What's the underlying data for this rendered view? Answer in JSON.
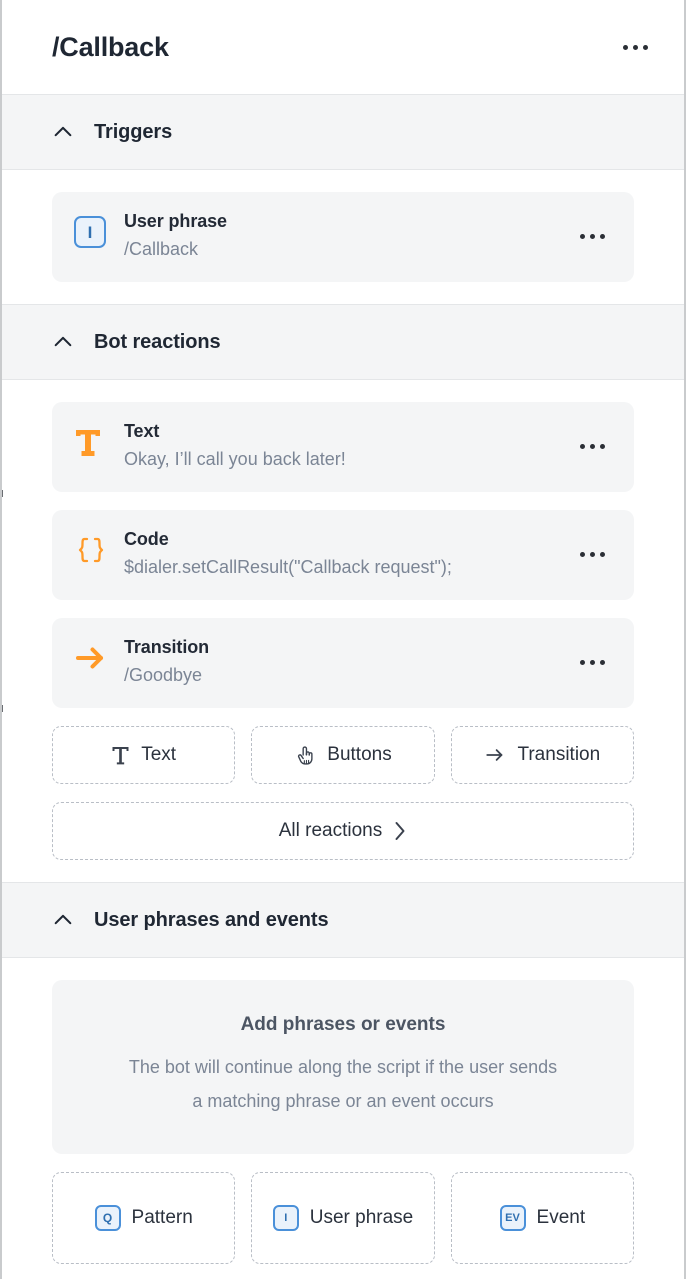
{
  "header": {
    "title": "/Callback",
    "more_label": "...",
    "more_icon": "ellipsis-horizontal-icon"
  },
  "sections": {
    "triggers": {
      "caption": "Triggers",
      "chevron_icon": "chevron-up-icon",
      "items": [
        {
          "icon": "user-phrase-icon",
          "glyph": "I",
          "title": "User phrase",
          "subtitle": "/Callback",
          "more_icon": "ellipsis-horizontal-icon"
        }
      ]
    },
    "bot_reactions": {
      "caption": "Bot reactions",
      "chevron_icon": "chevron-up-icon",
      "items": [
        {
          "icon": "text-t-icon",
          "title": "Text",
          "subtitle": "Okay, I’ll call you back later!",
          "more_icon": "ellipsis-horizontal-icon"
        },
        {
          "icon": "code-braces-icon",
          "title": "Code",
          "subtitle": "$dialer.setCallResult(\"Callback request\");",
          "more_icon": "ellipsis-horizontal-icon"
        },
        {
          "icon": "arrow-right-icon",
          "title": "Transition",
          "subtitle": "/Goodbye",
          "more_icon": "ellipsis-horizontal-icon"
        }
      ],
      "add_buttons": [
        {
          "label": "Text",
          "icon": "text-t-icon"
        },
        {
          "label": "Buttons",
          "icon": "pointing-hand-icon"
        },
        {
          "label": "Transition",
          "icon": "arrow-right-icon"
        }
      ],
      "all_reactions": {
        "label": "All reactions",
        "icon": "chevron-right-icon"
      }
    },
    "user_phrases": {
      "caption": "User phrases and events",
      "chevron_icon": "chevron-up-icon",
      "empty_state": {
        "title": "Add phrases or events",
        "description_line1": "The bot will continue along the script if the user sends",
        "description_line2": "a matching phrase or an event occurs"
      },
      "add_buttons": [
        {
          "label": "Pattern",
          "icon": "pattern-q-icon",
          "glyph": "Q"
        },
        {
          "label": "User phrase",
          "icon": "user-phrase-icon",
          "glyph": "I"
        },
        {
          "label": "Event",
          "icon": "event-ev-icon",
          "glyph": "EV"
        }
      ]
    }
  },
  "colors": {
    "accent_orange": "#ff9a28",
    "accent_blue": "#4a90d9",
    "badge_fill": "#eaf2fb",
    "card_bg": "#f4f5f6",
    "section_bg": "#f4f5f6",
    "title_text": "#1f2733",
    "muted_text": "#7b8595"
  }
}
